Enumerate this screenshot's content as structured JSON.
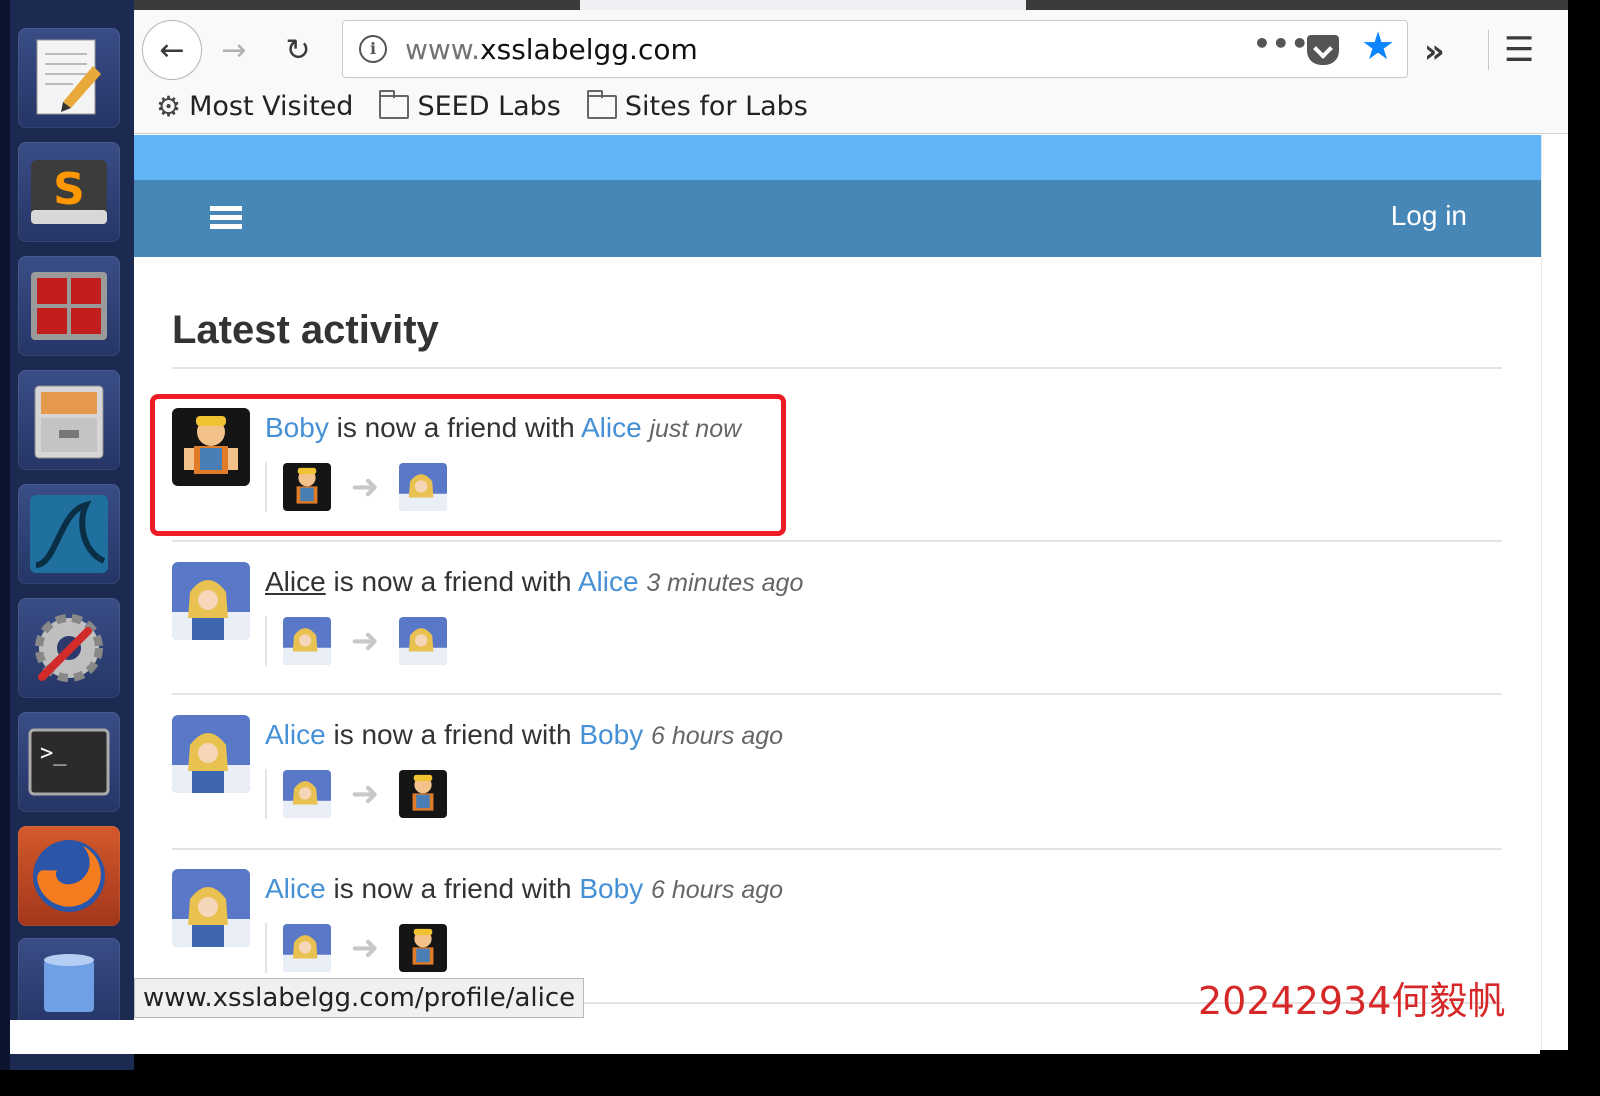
{
  "browser": {
    "url_prefix": "www.",
    "url_domain": "xsslabelgg.com",
    "bookmarks": [
      "Most Visited",
      "SEED Labs",
      "Sites for Labs"
    ]
  },
  "site": {
    "login": "Log in",
    "heading": "Latest activity"
  },
  "activity": [
    {
      "actor": "Boby",
      "verb": "is now a friend with",
      "target": "Alice",
      "time": "just now"
    },
    {
      "actor": "Alice",
      "verb": "is now a friend with",
      "target": "Alice",
      "time": "3 minutes ago"
    },
    {
      "actor": "Alice",
      "verb": "is now a friend with",
      "target": "Boby",
      "time": "6 hours ago"
    },
    {
      "actor": "Alice",
      "verb": "is now a friend with",
      "target": "Boby",
      "time": "6 hours ago"
    }
  ],
  "status_url": "www.xsslabelgg.com/profile/alice",
  "watermark": "20242934何毅帆",
  "colors": {
    "link": "#4690d6",
    "navband": "#4787b8",
    "topband": "#61b4f5",
    "highlight": "#ee1c25"
  }
}
